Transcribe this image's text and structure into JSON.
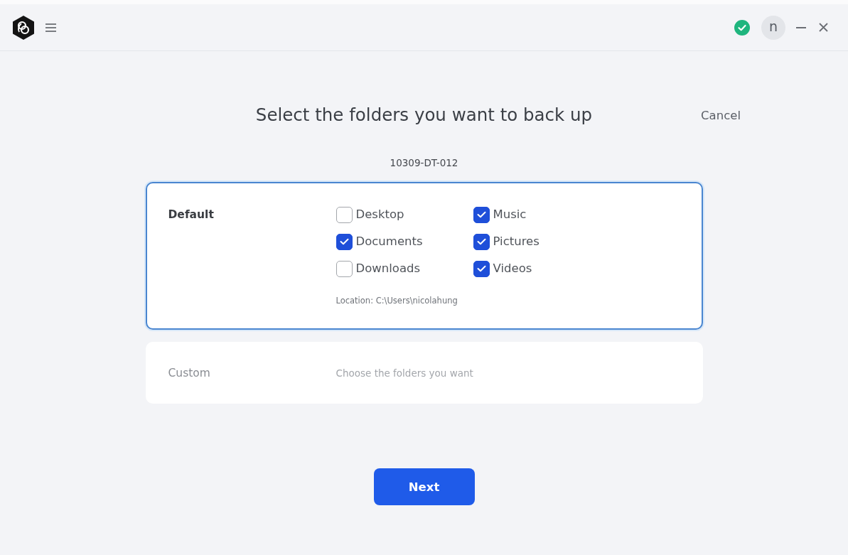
{
  "header": {
    "status": {
      "ok": true
    },
    "avatar": "n"
  },
  "page": {
    "title": "Select the folders you want to back up",
    "cancel": "Cancel",
    "device": "10309-DT-012"
  },
  "backup_options": [
    {
      "label": "Default",
      "selected": true,
      "folders": [
        {
          "label": "Desktop",
          "checked": false
        },
        {
          "label": "Music",
          "checked": true
        },
        {
          "label": "Documents",
          "checked": true
        },
        {
          "label": "Pictures",
          "checked": true
        },
        {
          "label": "Downloads",
          "checked": false
        },
        {
          "label": "Videos",
          "checked": true
        }
      ],
      "location": "Location: C:\\Users\\nicolahung"
    },
    {
      "label": "Custom",
      "selected": false,
      "description": "Choose the folders you want"
    }
  ],
  "buttons": {
    "next": "Next"
  }
}
